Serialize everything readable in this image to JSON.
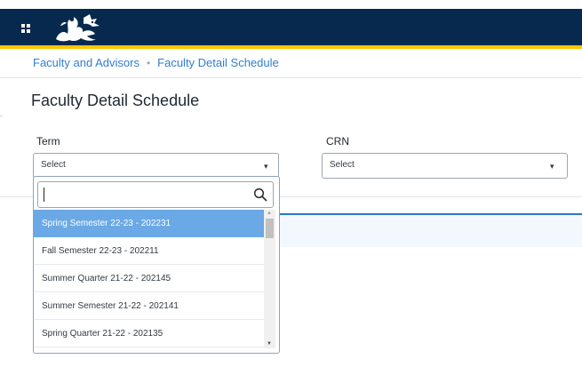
{
  "header": {
    "apps_icon": "grid-icon",
    "logo_icon": "dragon-logo-icon",
    "colors": {
      "bar": "#07294d",
      "accent": "#ffc600"
    }
  },
  "breadcrumb": {
    "items": [
      "Faculty and Advisors",
      "Faculty Detail Schedule"
    ],
    "separator": "•"
  },
  "page": {
    "title": "Faculty Detail Schedule"
  },
  "term": {
    "label": "Term",
    "value": "Select",
    "search_value": "",
    "search_icon": "search-icon",
    "options": [
      {
        "label": "Spring Semester 22-23 - 202231",
        "selected": true
      },
      {
        "label": "Fall Semester 22-23 - 202211",
        "selected": false
      },
      {
        "label": "Summer Quarter 21-22 - 202145",
        "selected": false
      },
      {
        "label": "Summer Semester 21-22 - 202141",
        "selected": false
      },
      {
        "label": "Spring Quarter 21-22 - 202135",
        "selected": false
      }
    ]
  },
  "crn": {
    "label": "CRN",
    "value": "Select"
  },
  "colors": {
    "link": "#2f7fd0",
    "selected_option": "#6aa9e6",
    "table_accent": "#2c74c6"
  }
}
